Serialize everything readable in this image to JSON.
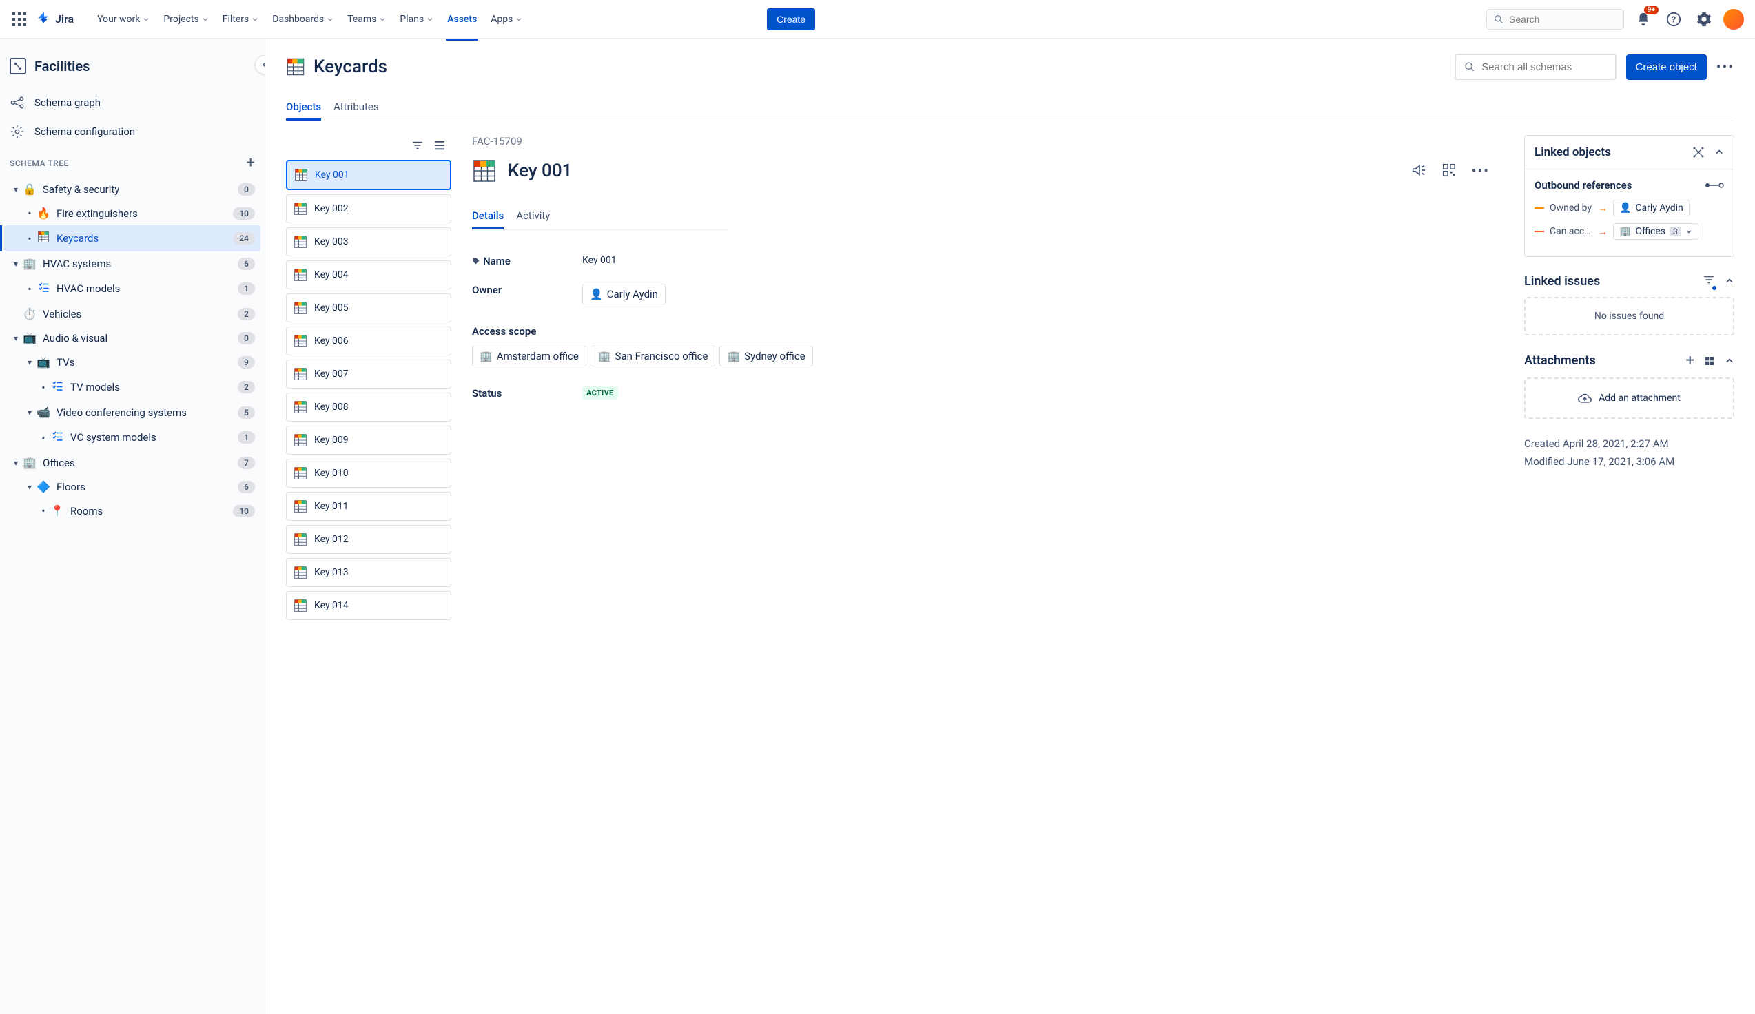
{
  "topnav": {
    "logo": "Jira",
    "items": [
      {
        "label": "Your work",
        "chev": true
      },
      {
        "label": "Projects",
        "chev": true
      },
      {
        "label": "Filters",
        "chev": true
      },
      {
        "label": "Dashboards",
        "chev": true
      },
      {
        "label": "Teams",
        "chev": true
      },
      {
        "label": "Plans",
        "chev": true
      },
      {
        "label": "Assets",
        "chev": false,
        "active": true
      },
      {
        "label": "Apps",
        "chev": true
      }
    ],
    "create": "Create",
    "search_placeholder": "Search",
    "notif_badge": "9+"
  },
  "sidebar": {
    "title": "Facilities",
    "schema_graph": "Schema graph",
    "schema_config": "Schema configuration",
    "tree_label": "SCHEMA TREE",
    "tree": [
      {
        "indent": 0,
        "chev": true,
        "icon": "🔒",
        "label": "Safety & security",
        "count": "0",
        "iconbg": "#FF8B00"
      },
      {
        "indent": 1,
        "dot": true,
        "icon": "🔥",
        "label": "Fire extinguishers",
        "count": "10"
      },
      {
        "indent": 1,
        "dot": true,
        "icon": "grid",
        "label": "Keycards",
        "count": "24",
        "selected": true
      },
      {
        "indent": 0,
        "chev": true,
        "icon": "🏢",
        "label": "HVAC systems",
        "count": "6",
        "iconcolor": "#0052CC"
      },
      {
        "indent": 1,
        "dot": true,
        "icon": "✓≡",
        "label": "HVAC models",
        "count": "1"
      },
      {
        "indent": 0,
        "blank": true,
        "icon": "⏱️",
        "label": "Vehicles",
        "count": "2"
      },
      {
        "indent": 0,
        "chev": true,
        "icon": "📺",
        "label": "Audio & visual",
        "count": "0",
        "iconbg": "#253858"
      },
      {
        "indent": 1,
        "chev": true,
        "icon": "📺",
        "label": "TVs",
        "count": "9"
      },
      {
        "indent": 2,
        "dot": true,
        "icon": "✓≡",
        "label": "TV models",
        "count": "2"
      },
      {
        "indent": 1,
        "chev": true,
        "icon": "📹",
        "label": "Video conferencing systems",
        "count": "5"
      },
      {
        "indent": 2,
        "dot": true,
        "icon": "✓≡",
        "label": "VC system models",
        "count": "1"
      },
      {
        "indent": 0,
        "chev": true,
        "icon": "🏢",
        "label": "Offices",
        "count": "7",
        "iconcolor": "#0052CC"
      },
      {
        "indent": 1,
        "chev": true,
        "icon": "🔷",
        "label": "Floors",
        "count": "6"
      },
      {
        "indent": 2,
        "dot": true,
        "icon": "📍",
        "label": "Rooms",
        "count": "10"
      }
    ]
  },
  "header": {
    "title": "Keycards",
    "search_placeholder": "Search all schemas",
    "create_object": "Create object",
    "tabs": [
      {
        "label": "Objects",
        "active": true
      },
      {
        "label": "Attributes"
      }
    ]
  },
  "objects": [
    "Key 001",
    "Key 002",
    "Key 003",
    "Key 004",
    "Key 005",
    "Key 006",
    "Key 007",
    "Key 008",
    "Key 009",
    "Key 010",
    "Key 011",
    "Key 012",
    "Key 013",
    "Key 014"
  ],
  "detail": {
    "id": "FAC-15709",
    "title": "Key 001",
    "tabs": [
      {
        "label": "Details",
        "active": true
      },
      {
        "label": "Activity"
      }
    ],
    "fields": {
      "name_label": "Name",
      "name_value": "Key 001",
      "owner_label": "Owner",
      "owner_value": "Carly Aydin",
      "scope_label": "Access scope",
      "scope_values": [
        "Amsterdam office",
        "San Francisco office",
        "Sydney office"
      ],
      "status_label": "Status",
      "status_value": "ACTIVE"
    }
  },
  "rail": {
    "linked_objects": {
      "title": "Linked objects",
      "outbound": "Outbound references",
      "owned_by": "Owned by",
      "owned_value": "Carly Aydin",
      "can_access": "Can acc…",
      "can_value": "Offices",
      "can_count": "3"
    },
    "linked_issues": {
      "title": "Linked issues",
      "empty": "No issues found"
    },
    "attachments": {
      "title": "Attachments",
      "add": "Add an attachment"
    },
    "meta": {
      "created": "Created April 28, 2021, 2:27 AM",
      "modified": "Modified June 17, 2021, 3:06 AM"
    }
  }
}
